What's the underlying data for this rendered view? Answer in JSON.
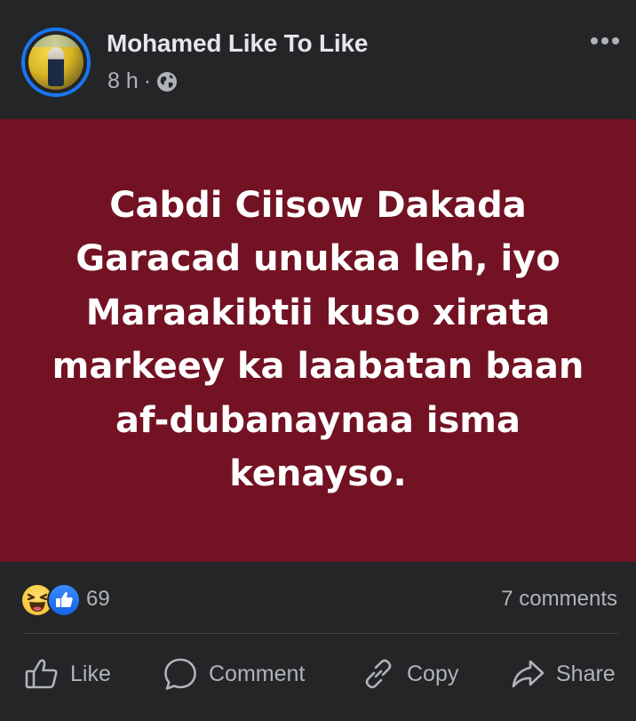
{
  "post": {
    "author": "Mohamed Like To Like",
    "time": "8 h",
    "separator": "·",
    "privacy_icon": "globe-icon",
    "more_icon": "more-horizontal-icon",
    "text": "Cabdi Ciisow Dakada Garacad unukaa leh, iyo Maraakibtii kuso xirata markeey ka laabatan baan af-dubanaynaa isma kenayso.",
    "background_color": "#721223"
  },
  "stats": {
    "reaction_icons": [
      "haha-icon",
      "like-icon"
    ],
    "reaction_count": "69",
    "comments": "7 comments"
  },
  "actions": {
    "like": "Like",
    "comment": "Comment",
    "copy": "Copy",
    "share": "Share"
  }
}
